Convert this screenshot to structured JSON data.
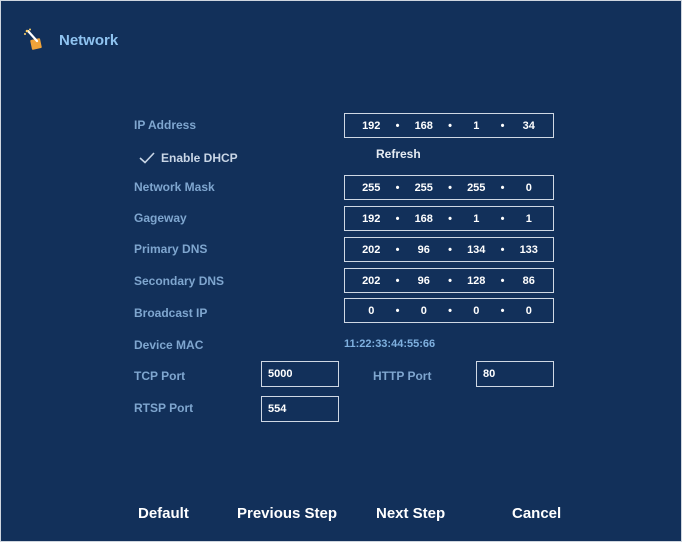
{
  "window": {
    "title": "Network",
    "title_icon": "network-wand-icon"
  },
  "fields": {
    "ip_address": {
      "label": "IP Address",
      "octets": [
        "192",
        "168",
        "1",
        "34"
      ]
    },
    "dhcp": {
      "label": "Enable DHCP",
      "checked": true
    },
    "refresh_label": "Refresh",
    "network_mask": {
      "label": "Network Mask",
      "octets": [
        "255",
        "255",
        "255",
        "0"
      ]
    },
    "gateway": {
      "label": "Gageway",
      "octets": [
        "192",
        "168",
        "1",
        "1"
      ]
    },
    "primary_dns": {
      "label": "Primary DNS",
      "octets": [
        "202",
        "96",
        "134",
        "133"
      ]
    },
    "secondary_dns": {
      "label": "Secondary DNS",
      "octets": [
        "202",
        "96",
        "128",
        "86"
      ]
    },
    "broadcast_ip": {
      "label": "Broadcast IP",
      "octets": [
        "0",
        "0",
        "0",
        "0"
      ]
    },
    "device_mac": {
      "label": "Device MAC",
      "value": "11:22:33:44:55:66"
    },
    "tcp_port": {
      "label": "TCP Port",
      "value": "5000"
    },
    "http_port": {
      "label": "HTTP Port",
      "value": "80"
    },
    "rtsp_port": {
      "label": "RTSP Port",
      "value": "554"
    }
  },
  "buttons": {
    "default": "Default",
    "previous": "Previous Step",
    "next": "Next Step",
    "cancel": "Cancel"
  },
  "colors": {
    "background": "#12305a",
    "label": "#7fa6cf",
    "title": "#8fc3f0",
    "value": "#ffffff",
    "border": "#cfd8e4"
  }
}
